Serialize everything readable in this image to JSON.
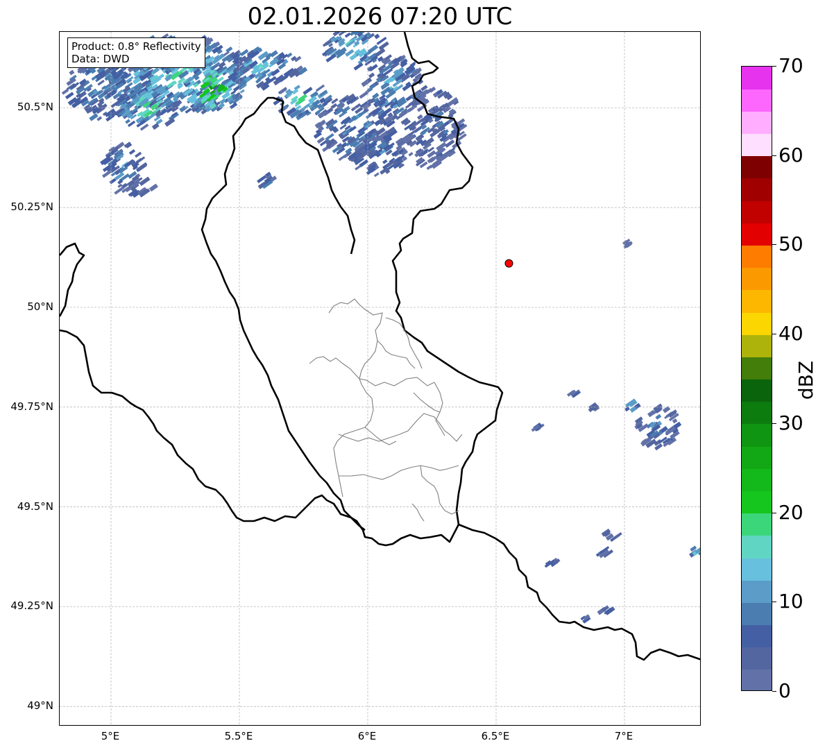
{
  "title": "02.01.2026 07:20 UTC",
  "info_box": {
    "product": "Product: 0.8° Reflectivity",
    "data_source": "Data: DWD"
  },
  "map": {
    "lon_range": [
      4.8,
      7.3
    ],
    "lat_range": [
      48.95,
      50.69
    ],
    "lat_ticks": [
      {
        "value": 50.5,
        "label": "50.5°N"
      },
      {
        "value": 50.25,
        "label": "50.25°N"
      },
      {
        "value": 50.0,
        "label": "50°N"
      },
      {
        "value": 49.75,
        "label": "49.75°N"
      },
      {
        "value": 49.5,
        "label": "49.5°N"
      },
      {
        "value": 49.25,
        "label": "49.25°N"
      },
      {
        "value": 49.0,
        "label": "49°N"
      }
    ],
    "lon_ticks": [
      {
        "value": 5.0,
        "label": "5°E"
      },
      {
        "value": 5.5,
        "label": "5.5°E"
      },
      {
        "value": 6.0,
        "label": "6°E"
      },
      {
        "value": 6.5,
        "label": "6.5°E"
      },
      {
        "value": 7.0,
        "label": "7°E"
      }
    ],
    "radar_site": {
      "lon": 6.55,
      "lat": 50.11,
      "color": "#ff0000"
    },
    "gridlines": true,
    "echo_cells": [
      {
        "lon": 5.0,
        "lat": 50.55,
        "rlon": 0.18,
        "rlat": 0.08,
        "dbz": 12
      },
      {
        "lon": 5.25,
        "lat": 50.58,
        "rlon": 0.3,
        "rlat": 0.1,
        "dbz": 16
      },
      {
        "lon": 5.4,
        "lat": 50.55,
        "rlon": 0.12,
        "rlat": 0.06,
        "dbz": 26
      },
      {
        "lon": 5.3,
        "lat": 50.62,
        "rlon": 0.12,
        "rlat": 0.04,
        "dbz": 22
      },
      {
        "lon": 5.15,
        "lat": 50.5,
        "rlon": 0.12,
        "rlat": 0.05,
        "dbz": 20
      },
      {
        "lon": 5.05,
        "lat": 50.35,
        "rlon": 0.08,
        "rlat": 0.06,
        "dbz": 10
      },
      {
        "lon": 5.6,
        "lat": 50.6,
        "rlon": 0.15,
        "rlat": 0.05,
        "dbz": 14
      },
      {
        "lon": 5.75,
        "lat": 50.52,
        "rlon": 0.1,
        "rlat": 0.04,
        "dbz": 18
      },
      {
        "lon": 5.95,
        "lat": 50.65,
        "rlon": 0.12,
        "rlat": 0.05,
        "dbz": 16
      },
      {
        "lon": 5.95,
        "lat": 50.45,
        "rlon": 0.15,
        "rlat": 0.08,
        "dbz": 10
      },
      {
        "lon": 6.1,
        "lat": 50.55,
        "rlon": 0.12,
        "rlat": 0.08,
        "dbz": 12
      },
      {
        "lon": 6.05,
        "lat": 50.38,
        "rlon": 0.12,
        "rlat": 0.05,
        "dbz": 8
      },
      {
        "lon": 6.25,
        "lat": 50.45,
        "rlon": 0.12,
        "rlat": 0.1,
        "dbz": 6
      },
      {
        "lon": 5.6,
        "lat": 50.32,
        "rlon": 0.04,
        "rlat": 0.02,
        "dbz": 8
      },
      {
        "lon": 5.12,
        "lat": 50.3,
        "rlon": 0.05,
        "rlat": 0.02,
        "dbz": 6
      },
      {
        "lon": 7.13,
        "lat": 49.7,
        "rlon": 0.08,
        "rlat": 0.05,
        "dbz": 8
      },
      {
        "lon": 7.03,
        "lat": 49.75,
        "rlon": 0.03,
        "rlat": 0.015,
        "dbz": 18
      },
      {
        "lon": 6.95,
        "lat": 49.43,
        "rlon": 0.03,
        "rlat": 0.01,
        "dbz": 8
      },
      {
        "lon": 6.93,
        "lat": 49.39,
        "rlon": 0.03,
        "rlat": 0.01,
        "dbz": 12
      },
      {
        "lon": 7.28,
        "lat": 49.39,
        "rlon": 0.02,
        "rlat": 0.01,
        "dbz": 16
      },
      {
        "lon": 6.93,
        "lat": 49.24,
        "rlon": 0.03,
        "rlat": 0.006,
        "dbz": 6
      },
      {
        "lon": 6.8,
        "lat": 49.78,
        "rlon": 0.015,
        "rlat": 0.006,
        "dbz": 6
      },
      {
        "lon": 6.88,
        "lat": 49.75,
        "rlon": 0.015,
        "rlat": 0.006,
        "dbz": 6
      },
      {
        "lon": 6.72,
        "lat": 49.36,
        "rlon": 0.02,
        "rlat": 0.005,
        "dbz": 10
      },
      {
        "lon": 6.84,
        "lat": 49.22,
        "rlon": 0.02,
        "rlat": 0.005,
        "dbz": 10
      },
      {
        "lon": 6.66,
        "lat": 49.7,
        "rlon": 0.01,
        "rlat": 0.004,
        "dbz": 6
      },
      {
        "lon": 7.01,
        "lat": 50.16,
        "rlon": 0.008,
        "rlat": 0.006,
        "dbz": 6
      }
    ]
  },
  "colorbar": {
    "unit": "dBZ",
    "min": 0,
    "max": 70,
    "ticks": [
      {
        "value": 0,
        "label": "0"
      },
      {
        "value": 10,
        "label": "10"
      },
      {
        "value": 20,
        "label": "20"
      },
      {
        "value": 30,
        "label": "30"
      },
      {
        "value": 40,
        "label": "40"
      },
      {
        "value": 50,
        "label": "50"
      },
      {
        "value": 60,
        "label": "60"
      },
      {
        "value": 70,
        "label": "70"
      }
    ],
    "colors": [
      "#6272a8",
      "#5466a0",
      "#445fa3",
      "#4c7db1",
      "#5b9cc8",
      "#67c0dd",
      "#61d5c4",
      "#3cd67a",
      "#14c61d",
      "#13b81a",
      "#12a815",
      "#0f9512",
      "#0c7c0f",
      "#0a640b",
      "#437d0a",
      "#aeb30b",
      "#fcd600",
      "#fdb700",
      "#fb9a00",
      "#fe7c00",
      "#e30000",
      "#c10000",
      "#a10000",
      "#7f0000",
      "#ffdfff",
      "#ffaeff",
      "#fd67fe",
      "#e633ee"
    ]
  }
}
